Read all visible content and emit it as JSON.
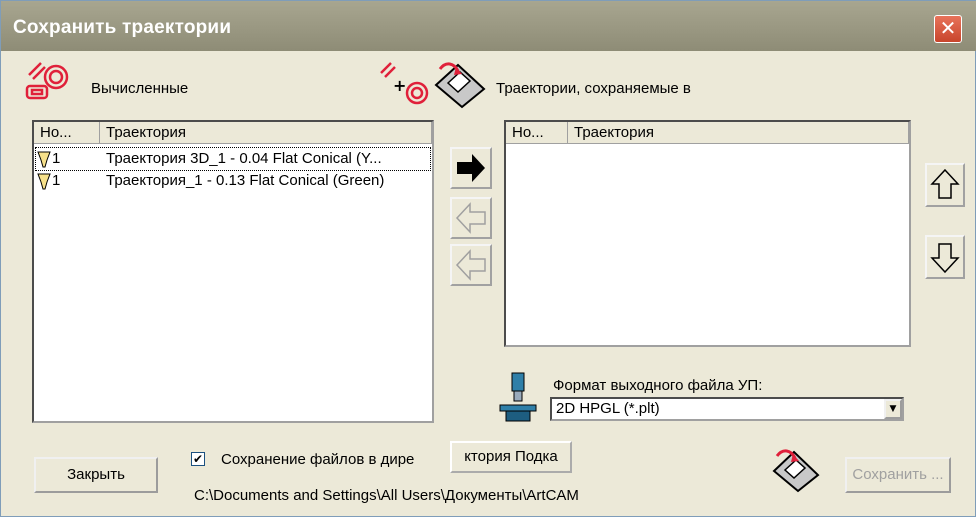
{
  "window": {
    "title": "Сохранить траектории",
    "close_glyph": "✕"
  },
  "left_panel": {
    "label": "Вычисленные",
    "columns": [
      "Но...",
      "Траектория"
    ],
    "rows": [
      {
        "num": "1",
        "name": "Траектория 3D_1 - 0.04 Flat Conical  (Y...",
        "selected": true
      },
      {
        "num": "1",
        "name": "Траектория_1 - 0.13 Flat Conical  (Green)",
        "selected": false
      }
    ]
  },
  "right_panel": {
    "label": "Траектории, сохраняемые в",
    "columns": [
      "Но...",
      "Траектория"
    ],
    "rows": []
  },
  "format": {
    "label": "Формат выходного файла УП:",
    "selected": "2D HPGL (*.plt)"
  },
  "save_to_folder": {
    "label": "Сохранение файлов в дире",
    "checked": true,
    "checkmark": "✔",
    "folder_button": "ктория Подка",
    "path": "C:\\Documents and Settings\\All Users\\Документы\\ArtCAM"
  },
  "buttons": {
    "close": "Закрыть",
    "save": "Сохранить ..."
  },
  "icons": {
    "computed": "toolpaths-icon",
    "add_to_save": "add-toolpath-icon",
    "disk": "floppy-save-icon",
    "machine": "machine-icon",
    "tool": "tool-bit-icon"
  },
  "colors": {
    "title_bar": "#8e8c76",
    "window_bg": "#ece9d8",
    "close_btn": "#d9573e",
    "icon_red": "#e0203a"
  }
}
